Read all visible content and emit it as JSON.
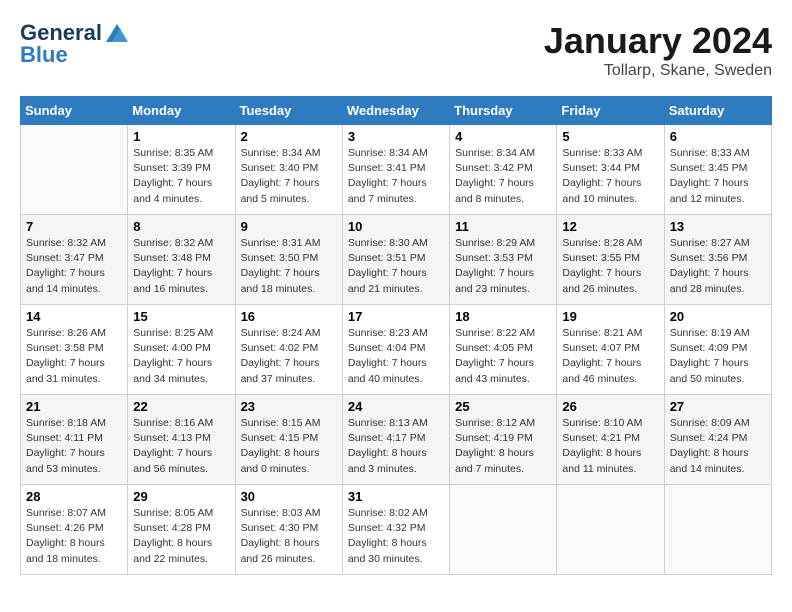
{
  "header": {
    "logo_line1": "General",
    "logo_line2": "Blue",
    "month": "January 2024",
    "location": "Tollarp, Skane, Sweden"
  },
  "days_of_week": [
    "Sunday",
    "Monday",
    "Tuesday",
    "Wednesday",
    "Thursday",
    "Friday",
    "Saturday"
  ],
  "weeks": [
    [
      {
        "day": "",
        "info": ""
      },
      {
        "day": "1",
        "info": "Sunrise: 8:35 AM\nSunset: 3:39 PM\nDaylight: 7 hours\nand 4 minutes."
      },
      {
        "day": "2",
        "info": "Sunrise: 8:34 AM\nSunset: 3:40 PM\nDaylight: 7 hours\nand 5 minutes."
      },
      {
        "day": "3",
        "info": "Sunrise: 8:34 AM\nSunset: 3:41 PM\nDaylight: 7 hours\nand 7 minutes."
      },
      {
        "day": "4",
        "info": "Sunrise: 8:34 AM\nSunset: 3:42 PM\nDaylight: 7 hours\nand 8 minutes."
      },
      {
        "day": "5",
        "info": "Sunrise: 8:33 AM\nSunset: 3:44 PM\nDaylight: 7 hours\nand 10 minutes."
      },
      {
        "day": "6",
        "info": "Sunrise: 8:33 AM\nSunset: 3:45 PM\nDaylight: 7 hours\nand 12 minutes."
      }
    ],
    [
      {
        "day": "7",
        "info": "Sunrise: 8:32 AM\nSunset: 3:47 PM\nDaylight: 7 hours\nand 14 minutes."
      },
      {
        "day": "8",
        "info": "Sunrise: 8:32 AM\nSunset: 3:48 PM\nDaylight: 7 hours\nand 16 minutes."
      },
      {
        "day": "9",
        "info": "Sunrise: 8:31 AM\nSunset: 3:50 PM\nDaylight: 7 hours\nand 18 minutes."
      },
      {
        "day": "10",
        "info": "Sunrise: 8:30 AM\nSunset: 3:51 PM\nDaylight: 7 hours\nand 21 minutes."
      },
      {
        "day": "11",
        "info": "Sunrise: 8:29 AM\nSunset: 3:53 PM\nDaylight: 7 hours\nand 23 minutes."
      },
      {
        "day": "12",
        "info": "Sunrise: 8:28 AM\nSunset: 3:55 PM\nDaylight: 7 hours\nand 26 minutes."
      },
      {
        "day": "13",
        "info": "Sunrise: 8:27 AM\nSunset: 3:56 PM\nDaylight: 7 hours\nand 28 minutes."
      }
    ],
    [
      {
        "day": "14",
        "info": "Sunrise: 8:26 AM\nSunset: 3:58 PM\nDaylight: 7 hours\nand 31 minutes."
      },
      {
        "day": "15",
        "info": "Sunrise: 8:25 AM\nSunset: 4:00 PM\nDaylight: 7 hours\nand 34 minutes."
      },
      {
        "day": "16",
        "info": "Sunrise: 8:24 AM\nSunset: 4:02 PM\nDaylight: 7 hours\nand 37 minutes."
      },
      {
        "day": "17",
        "info": "Sunrise: 8:23 AM\nSunset: 4:04 PM\nDaylight: 7 hours\nand 40 minutes."
      },
      {
        "day": "18",
        "info": "Sunrise: 8:22 AM\nSunset: 4:05 PM\nDaylight: 7 hours\nand 43 minutes."
      },
      {
        "day": "19",
        "info": "Sunrise: 8:21 AM\nSunset: 4:07 PM\nDaylight: 7 hours\nand 46 minutes."
      },
      {
        "day": "20",
        "info": "Sunrise: 8:19 AM\nSunset: 4:09 PM\nDaylight: 7 hours\nand 50 minutes."
      }
    ],
    [
      {
        "day": "21",
        "info": "Sunrise: 8:18 AM\nSunset: 4:11 PM\nDaylight: 7 hours\nand 53 minutes."
      },
      {
        "day": "22",
        "info": "Sunrise: 8:16 AM\nSunset: 4:13 PM\nDaylight: 7 hours\nand 56 minutes."
      },
      {
        "day": "23",
        "info": "Sunrise: 8:15 AM\nSunset: 4:15 PM\nDaylight: 8 hours\nand 0 minutes."
      },
      {
        "day": "24",
        "info": "Sunrise: 8:13 AM\nSunset: 4:17 PM\nDaylight: 8 hours\nand 3 minutes."
      },
      {
        "day": "25",
        "info": "Sunrise: 8:12 AM\nSunset: 4:19 PM\nDaylight: 8 hours\nand 7 minutes."
      },
      {
        "day": "26",
        "info": "Sunrise: 8:10 AM\nSunset: 4:21 PM\nDaylight: 8 hours\nand 11 minutes."
      },
      {
        "day": "27",
        "info": "Sunrise: 8:09 AM\nSunset: 4:24 PM\nDaylight: 8 hours\nand 14 minutes."
      }
    ],
    [
      {
        "day": "28",
        "info": "Sunrise: 8:07 AM\nSunset: 4:26 PM\nDaylight: 8 hours\nand 18 minutes."
      },
      {
        "day": "29",
        "info": "Sunrise: 8:05 AM\nSunset: 4:28 PM\nDaylight: 8 hours\nand 22 minutes."
      },
      {
        "day": "30",
        "info": "Sunrise: 8:03 AM\nSunset: 4:30 PM\nDaylight: 8 hours\nand 26 minutes."
      },
      {
        "day": "31",
        "info": "Sunrise: 8:02 AM\nSunset: 4:32 PM\nDaylight: 8 hours\nand 30 minutes."
      },
      {
        "day": "",
        "info": ""
      },
      {
        "day": "",
        "info": ""
      },
      {
        "day": "",
        "info": ""
      }
    ]
  ]
}
